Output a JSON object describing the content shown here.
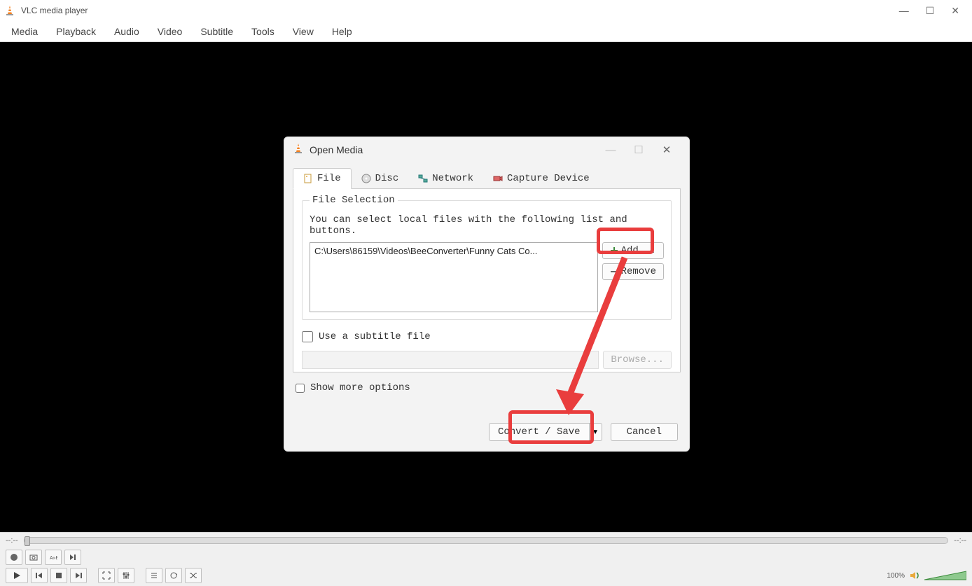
{
  "titlebar": {
    "title": "VLC media player"
  },
  "menubar": [
    "Media",
    "Playback",
    "Audio",
    "Video",
    "Subtitle",
    "Tools",
    "View",
    "Help"
  ],
  "dialog": {
    "title": "Open Media",
    "tabs": [
      {
        "label": "File",
        "active": true
      },
      {
        "label": "Disc",
        "active": false
      },
      {
        "label": "Network",
        "active": false
      },
      {
        "label": "Capture Device",
        "active": false
      }
    ],
    "file_selection": {
      "legend": "File Selection",
      "hint": "You can select local files with the following list and buttons.",
      "files": [
        "C:\\Users\\86159\\Videos\\BeeConverter\\Funny Cats Co..."
      ],
      "add_label": "Add...",
      "remove_label": "Remove"
    },
    "subtitle": {
      "label": "Use a subtitle file",
      "browse_label": "Browse..."
    },
    "more_options_label": "Show more options",
    "convert_label": "Convert / Save",
    "cancel_label": "Cancel"
  },
  "bottom": {
    "time_elapsed": "--:--",
    "time_total": "--:--",
    "volume_pct": "100%"
  }
}
